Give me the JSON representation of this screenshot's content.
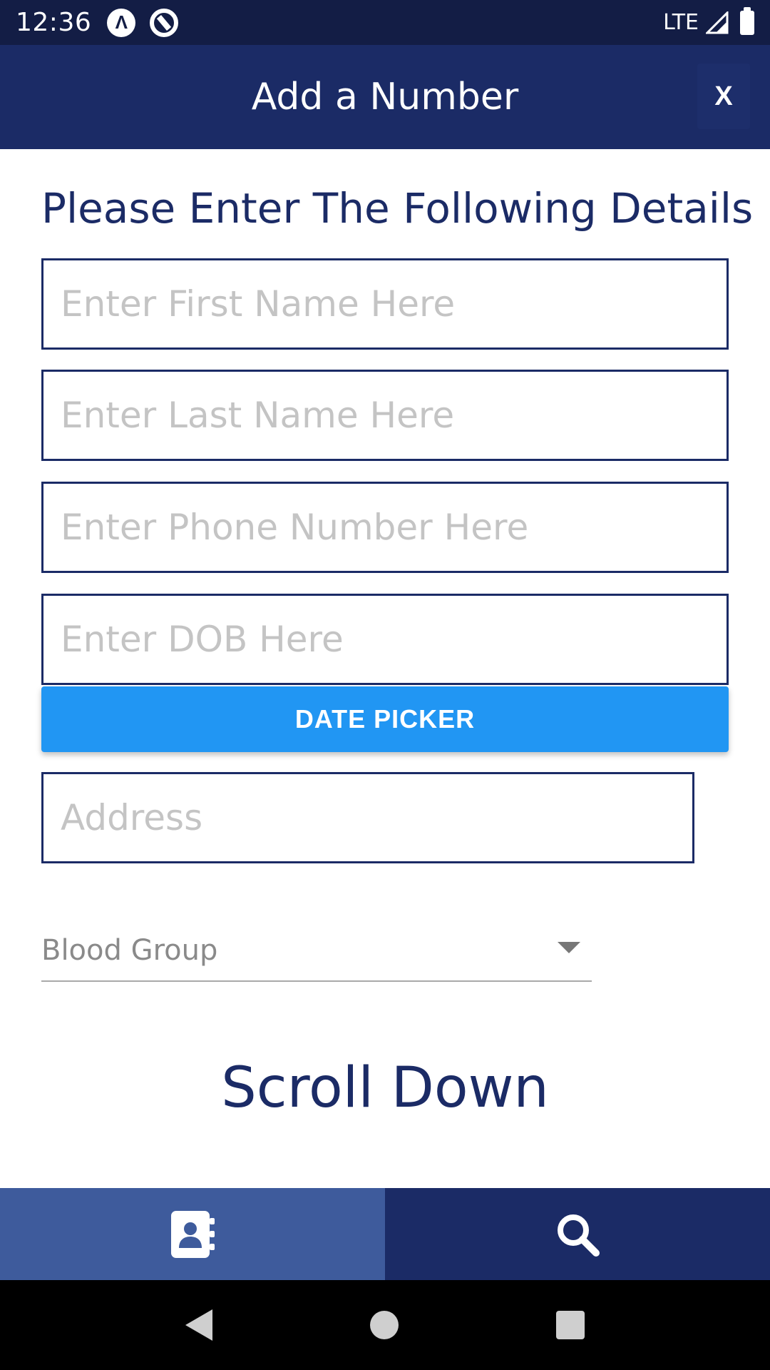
{
  "status_bar": {
    "time": "12:36",
    "app_icon_1": "a-badge-icon",
    "app_icon_2": "at-sign-icon",
    "network": "LTE",
    "signal_icon": "signal-icon",
    "battery_icon": "battery-icon"
  },
  "app_bar": {
    "title": "Add a Number",
    "close_label": "X"
  },
  "form": {
    "heading": "Please Enter The Following Details",
    "first_name_placeholder": "Enter First Name Here",
    "last_name_placeholder": "Enter Last Name Here",
    "phone_placeholder": "Enter Phone Number Here",
    "dob_placeholder": "Enter DOB Here",
    "date_picker_label": "DATE PICKER",
    "address_placeholder": "Address",
    "blood_group_label": "Blood Group",
    "scroll_hint": "Scroll Down"
  },
  "tabs": [
    {
      "icon": "contacts-book-icon",
      "active": true
    },
    {
      "icon": "search-icon",
      "active": false
    }
  ],
  "nav_bar": {
    "back_icon": "back-icon",
    "home_icon": "home-icon",
    "recents_icon": "recents-icon"
  },
  "colors": {
    "status_bar": "#131d45",
    "primary": "#1b2b66",
    "accent_button": "#2196f3",
    "active_tab": "#3e5b9c",
    "placeholder": "#c4c4c4"
  }
}
